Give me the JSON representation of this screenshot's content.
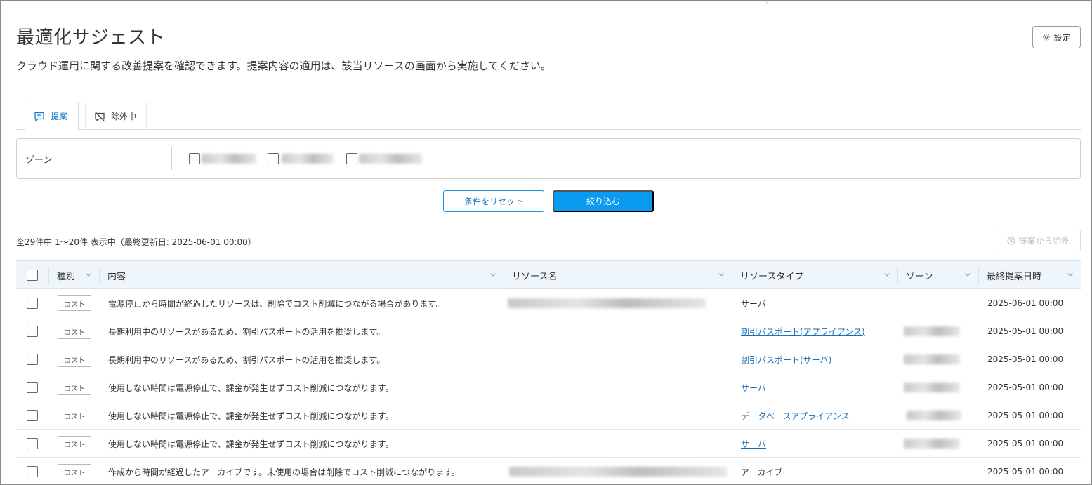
{
  "page": {
    "title": "最適化サジェスト",
    "description": "クラウド運用に関する改善提案を確認できます。提案内容の適用は、該当リソースの画面から実施してください。",
    "settings_label": "設定"
  },
  "tabs": [
    {
      "label": "提案",
      "active": true,
      "icon": "comment-icon"
    },
    {
      "label": "除外中",
      "active": false,
      "icon": "hidden-icon"
    }
  ],
  "filter": {
    "zone_label": "ゾーン",
    "reset_label": "条件をリセット",
    "apply_label": "絞り込む"
  },
  "results": {
    "summary": "全29件中 1～20件 表示中（最終更新日: 2025-06-01 00:00）",
    "exclude_label": "提案から除外"
  },
  "table": {
    "headers": {
      "kind": "種別",
      "content": "内容",
      "resource_name": "リソース名",
      "resource_type": "リソースタイプ",
      "zone": "ゾーン",
      "last_date": "最終提案日時"
    },
    "rows": [
      {
        "kind": "コスト",
        "content": "電源停止から時間が経過したリソースは、削除でコスト削減につながる場合があります。",
        "resource_type": "サーバ",
        "type_link": false,
        "date": "2025-06-01 00:00"
      },
      {
        "kind": "コスト",
        "content": "長期利用中のリソースがあるため、割引パスポートの活用を推奨します。",
        "resource_type": "割引パスポート(アプライアンス)",
        "type_link": true,
        "date": "2025-05-01 00:00"
      },
      {
        "kind": "コスト",
        "content": "長期利用中のリソースがあるため、割引パスポートの活用を推奨します。",
        "resource_type": "割引パスポート(サーバ)",
        "type_link": true,
        "date": "2025-05-01 00:00"
      },
      {
        "kind": "コスト",
        "content": "使用しない時間は電源停止で、課金が発生せずコスト削減につながります。",
        "resource_type": "サーバ",
        "type_link": true,
        "date": "2025-05-01 00:00"
      },
      {
        "kind": "コスト",
        "content": "使用しない時間は電源停止で、課金が発生せずコスト削減につながります。",
        "resource_type": "データベースアプライアンス",
        "type_link": true,
        "date": "2025-05-01 00:00"
      },
      {
        "kind": "コスト",
        "content": "使用しない時間は電源停止で、課金が発生せずコスト削減につながります。",
        "resource_type": "サーバ",
        "type_link": true,
        "date": "2025-05-01 00:00"
      },
      {
        "kind": "コスト",
        "content": "作成から時間が経過したアーカイブです。未使用の場合は削除でコスト削減につながります。",
        "resource_type": "アーカイブ",
        "type_link": false,
        "date": "2025-05-01 00:00"
      }
    ]
  },
  "colors": {
    "accent": "#0a9bf0",
    "link": "#1a6fb8",
    "header_bg": "#eef6fb"
  }
}
